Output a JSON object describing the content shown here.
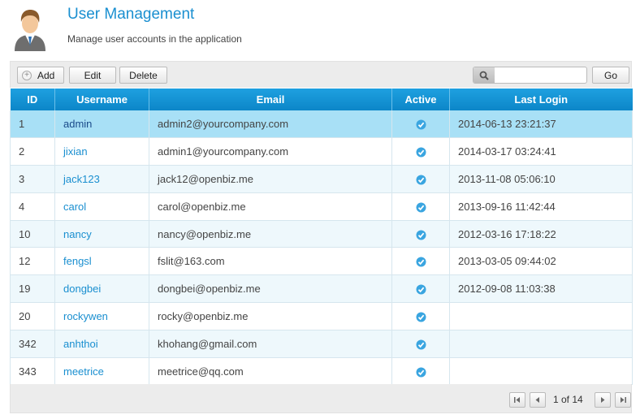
{
  "header": {
    "title": "User Management",
    "subtitle": "Manage user accounts in the application"
  },
  "toolbar": {
    "add_label": "Add",
    "edit_label": "Edit",
    "delete_label": "Delete",
    "search_value": "",
    "go_label": "Go"
  },
  "table": {
    "columns": [
      "ID",
      "Username",
      "Email",
      "Active",
      "Last Login"
    ],
    "rows": [
      {
        "id": "1",
        "username": "admin",
        "email": "admin2@yourcompany.com",
        "active": true,
        "last_login": "2014-06-13 23:21:37"
      },
      {
        "id": "2",
        "username": "jixian",
        "email": "admin1@yourcompany.com",
        "active": true,
        "last_login": "2014-03-17 03:24:41"
      },
      {
        "id": "3",
        "username": "jack123",
        "email": "jack12@openbiz.me",
        "active": true,
        "last_login": "2013-11-08 05:06:10"
      },
      {
        "id": "4",
        "username": "carol",
        "email": "carol@openbiz.me",
        "active": true,
        "last_login": "2013-09-16 11:42:44"
      },
      {
        "id": "10",
        "username": "nancy",
        "email": "nancy@openbiz.me",
        "active": true,
        "last_login": "2012-03-16 17:18:22"
      },
      {
        "id": "12",
        "username": "fengsl",
        "email": "fslit@163.com",
        "active": true,
        "last_login": "2013-03-05 09:44:02"
      },
      {
        "id": "19",
        "username": "dongbei",
        "email": "dongbei@openbiz.me",
        "active": true,
        "last_login": "2012-09-08 11:03:38"
      },
      {
        "id": "20",
        "username": "rockywen",
        "email": "rocky@openbiz.me",
        "active": true,
        "last_login": ""
      },
      {
        "id": "342",
        "username": "anhthoi",
        "email": "khohang@gmail.com",
        "active": true,
        "last_login": ""
      },
      {
        "id": "343",
        "username": "meetrice",
        "email": "meetrice@qq.com",
        "active": true,
        "last_login": ""
      }
    ],
    "selected_row_index": 0
  },
  "pager": {
    "page_text": "1 of 14"
  },
  "icons": {
    "avatar": "user-avatar-icon",
    "add": "plus-circle-icon",
    "search": "magnifier-icon",
    "active": "checkmark-circle-icon",
    "first": "first-page-icon",
    "prev": "previous-page-icon",
    "next": "next-page-icon",
    "last": "last-page-icon"
  },
  "colors": {
    "accent": "#1a8fd0",
    "header_bar": "#0c86c8",
    "selected_row": "#a8e0f6",
    "alt_row": "#eef8fc"
  }
}
